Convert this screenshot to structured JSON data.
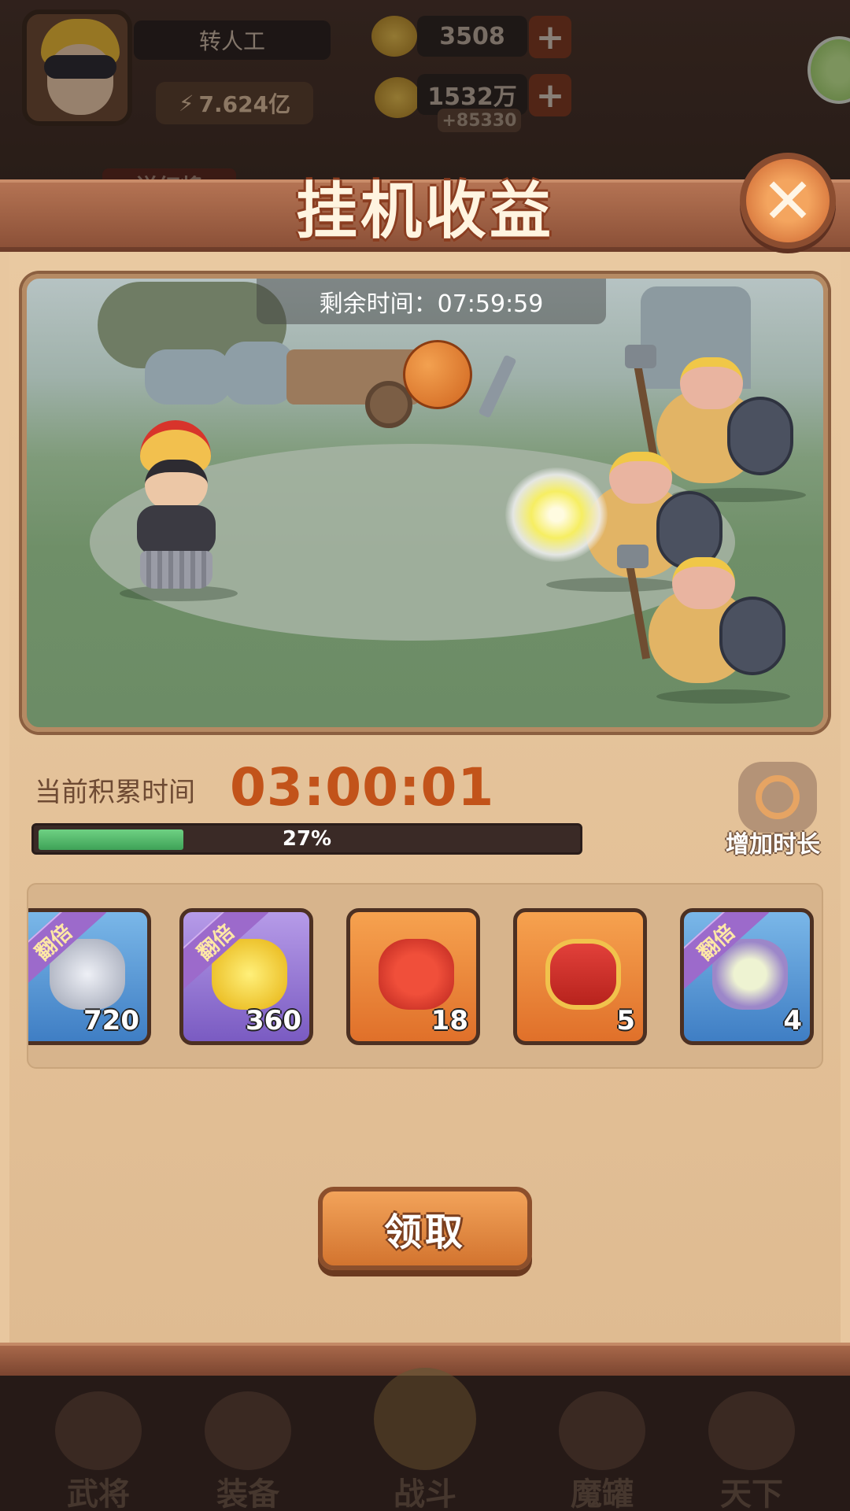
{
  "hud": {
    "player_name": "转人工",
    "power": "7.624亿",
    "gold_ingot": "3508",
    "coins": "1532万",
    "coin_gain": "+85330",
    "gift_general_label": "送红将"
  },
  "panel": {
    "title": "挂机收益",
    "remaining_time_label": "剩余时间：07:59:59",
    "accumulated_label": "当前积累时间",
    "accumulated_time": "03:00:01",
    "progress_fraction": 0.27,
    "progress_text": "27%",
    "add_time_label": "增加时长",
    "claim_label": "领取"
  },
  "rewards": [
    {
      "item": "ore",
      "quantity": "720",
      "tag": "翻倍",
      "frame": "blue"
    },
    {
      "item": "gold-ingot",
      "quantity": "360",
      "tag": "翻倍",
      "frame": "purple"
    },
    {
      "item": "lucky-bag",
      "quantity": "18",
      "tag": "",
      "frame": "orange"
    },
    {
      "item": "card-pack",
      "quantity": "5",
      "tag": "",
      "frame": "orange"
    },
    {
      "item": "tofu-dish",
      "quantity": "4",
      "tag": "翻倍",
      "frame": "blue"
    }
  ],
  "nav": {
    "items": [
      {
        "label": "武将"
      },
      {
        "label": "装备"
      },
      {
        "label": "战斗"
      },
      {
        "label": "魔罐"
      },
      {
        "label": "天下"
      }
    ]
  },
  "colors": {
    "accent_orange": "#c2531a",
    "progress_green": "#3ea257",
    "panel_bg": "#e8c79f"
  }
}
